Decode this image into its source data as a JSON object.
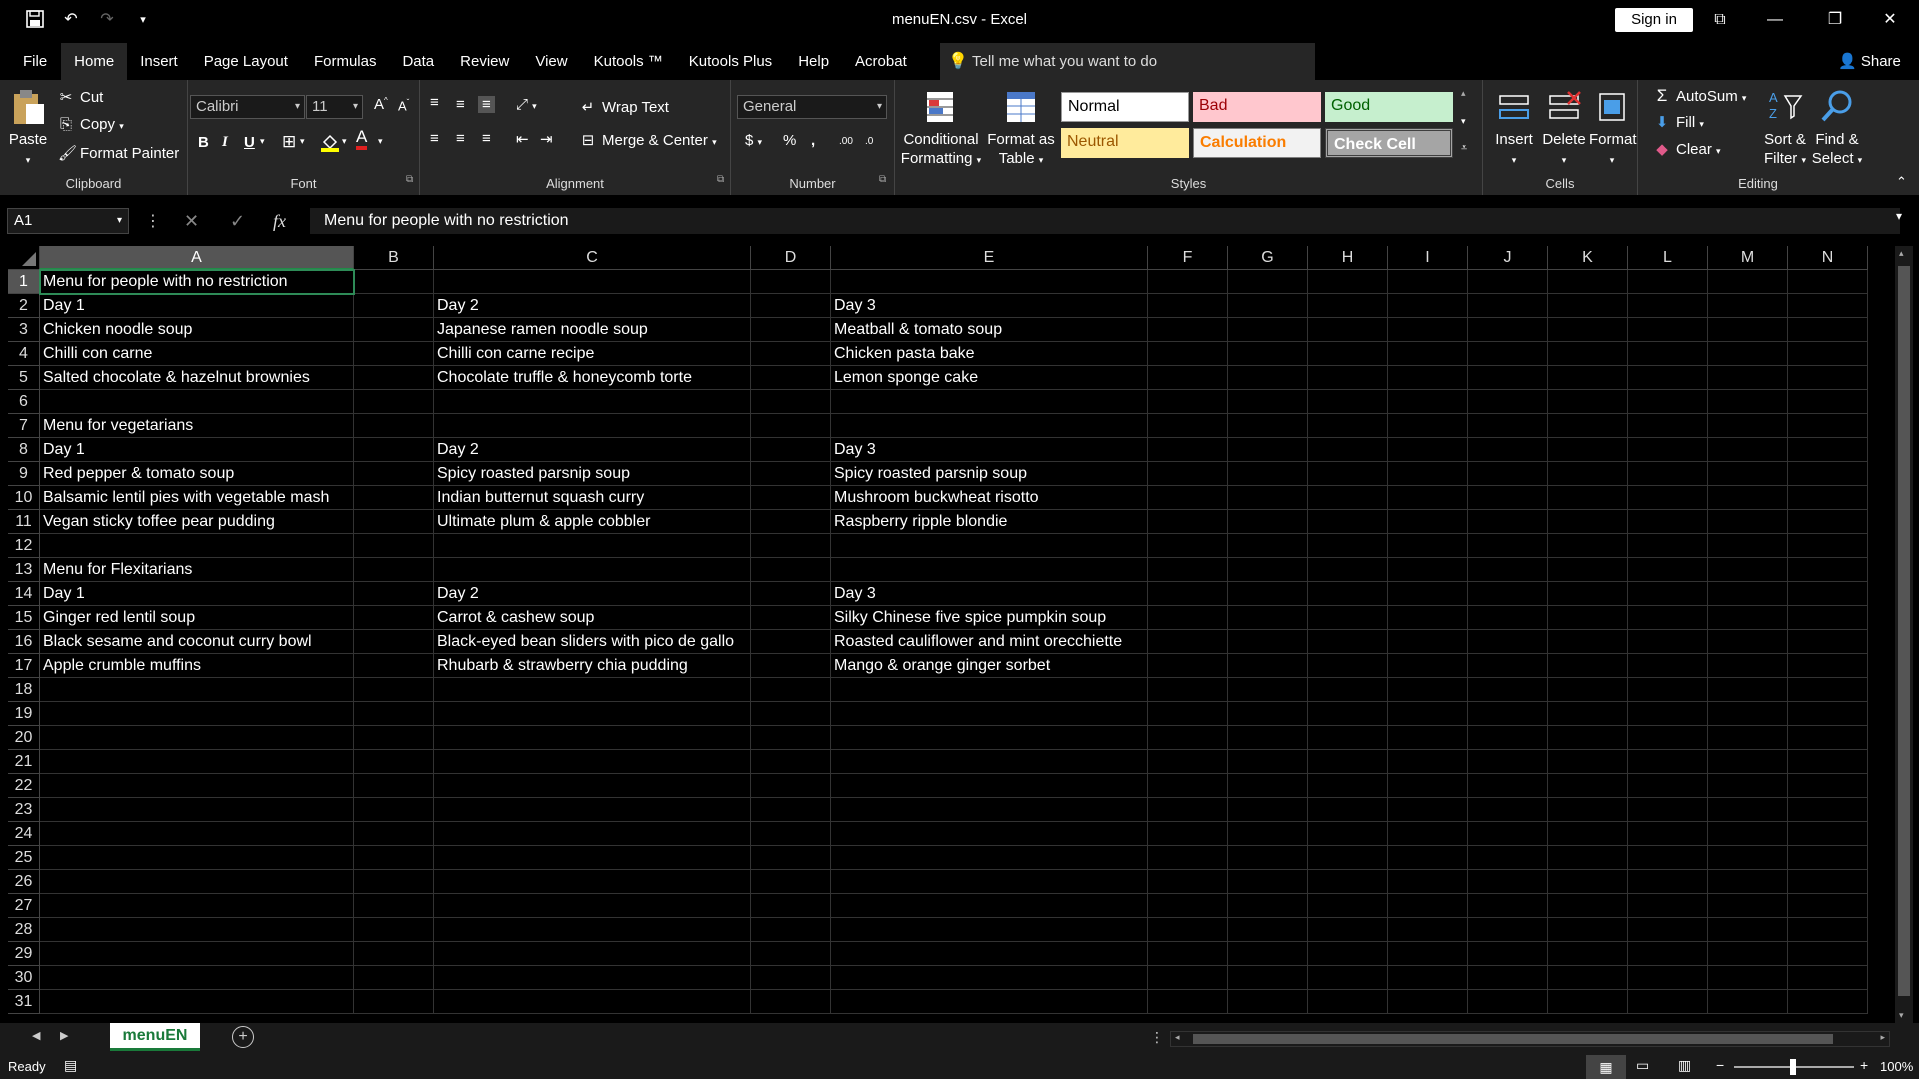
{
  "window": {
    "title": "menuEN.csv  -  Excel",
    "signin_label": "Sign in",
    "share_label": "Share"
  },
  "menu": {
    "tabs": [
      "File",
      "Home",
      "Insert",
      "Page Layout",
      "Formulas",
      "Data",
      "Review",
      "View",
      "Kutools ™",
      "Kutools Plus",
      "Help",
      "Acrobat"
    ],
    "active": "Home",
    "tell_me": "Tell me what you want to do"
  },
  "ribbon": {
    "clipboard": {
      "paste": "Paste",
      "cut": "Cut",
      "copy": "Copy",
      "format_painter": "Format Painter",
      "label": "Clipboard"
    },
    "font": {
      "name": "Calibri",
      "size": "11",
      "label": "Font"
    },
    "alignment": {
      "wrap_text": "Wrap Text",
      "merge_center": "Merge & Center",
      "label": "Alignment"
    },
    "number": {
      "format": "General",
      "label": "Number"
    },
    "styles": {
      "conditional_formatting": "Conditional Formatting",
      "format_as_table": "Format as Table",
      "normal": "Normal",
      "bad": "Bad",
      "good": "Good",
      "neutral": "Neutral",
      "calculation": "Calculation",
      "check_cell": "Check Cell",
      "label": "Styles"
    },
    "cells": {
      "insert": "Insert",
      "delete": "Delete",
      "format": "Format",
      "label": "Cells"
    },
    "editing": {
      "autosum": "AutoSum",
      "fill": "Fill",
      "clear": "Clear",
      "sort_filter": "Sort & Filter",
      "find_select": "Find & Select",
      "label": "Editing"
    }
  },
  "formula_bar": {
    "name_box": "A1",
    "formula": "Menu for people with no restriction"
  },
  "columns": [
    "A",
    "B",
    "C",
    "D",
    "E",
    "F",
    "G",
    "H",
    "I",
    "J",
    "K",
    "L",
    "M",
    "N"
  ],
  "rows": [
    {
      "n": "1",
      "A": "Menu for people with no restriction",
      "C": "",
      "E": ""
    },
    {
      "n": "2",
      "A": "Day 1",
      "C": "Day 2",
      "E": "Day 3"
    },
    {
      "n": "3",
      "A": "Chicken noodle soup",
      "C": "Japanese ramen noodle soup",
      "E": "Meatball & tomato soup"
    },
    {
      "n": "4",
      "A": "Chilli con carne",
      "C": "Chilli con carne recipe",
      "E": "Chicken pasta bake"
    },
    {
      "n": "5",
      "A": "Salted chocolate & hazelnut brownies",
      "C": "Chocolate truffle & honeycomb torte",
      "E": "Lemon sponge cake"
    },
    {
      "n": "6",
      "A": "",
      "C": "",
      "E": ""
    },
    {
      "n": "7",
      "A": "Menu for vegetarians",
      "C": "",
      "E": ""
    },
    {
      "n": "8",
      "A": "Day 1",
      "C": "Day 2",
      "E": "Day 3"
    },
    {
      "n": "9",
      "A": "Red pepper & tomato soup",
      "C": "Spicy roasted parsnip soup",
      "E": "Spicy roasted parsnip soup"
    },
    {
      "n": "10",
      "A": "Balsamic lentil pies with vegetable mash",
      "C": "Indian butternut squash curry",
      "E": "Mushroom buckwheat risotto"
    },
    {
      "n": "11",
      "A": "Vegan sticky toffee pear pudding",
      "C": "Ultimate plum & apple cobbler",
      "E": "Raspberry ripple blondie"
    },
    {
      "n": "12",
      "A": "",
      "C": "",
      "E": ""
    },
    {
      "n": "13",
      "A": "Menu for Flexitarians",
      "C": "",
      "E": ""
    },
    {
      "n": "14",
      "A": "Day 1",
      "C": "Day 2",
      "E": "Day 3"
    },
    {
      "n": "15",
      "A": "Ginger red lentil soup",
      "C": "Carrot & cashew soup",
      "E": "Silky Chinese five spice pumpkin soup"
    },
    {
      "n": "16",
      "A": "Black sesame and coconut curry bowl",
      "C": "Black-eyed bean sliders with pico de gallo",
      "E": "Roasted cauliflower and mint orecchiette"
    },
    {
      "n": "17",
      "A": "Apple crumble muffins",
      "C": "Rhubarb & strawberry chia pudding",
      "E": "Mango & orange ginger sorbet"
    },
    {
      "n": "18",
      "A": "",
      "C": "",
      "E": ""
    },
    {
      "n": "19",
      "A": "",
      "C": "",
      "E": ""
    },
    {
      "n": "20",
      "A": "",
      "C": "",
      "E": ""
    },
    {
      "n": "21",
      "A": "",
      "C": "",
      "E": ""
    },
    {
      "n": "22",
      "A": "",
      "C": "",
      "E": ""
    },
    {
      "n": "23",
      "A": "",
      "C": "",
      "E": ""
    },
    {
      "n": "24",
      "A": "",
      "C": "",
      "E": ""
    },
    {
      "n": "25",
      "A": "",
      "C": "",
      "E": ""
    },
    {
      "n": "26",
      "A": "",
      "C": "",
      "E": ""
    },
    {
      "n": "27",
      "A": "",
      "C": "",
      "E": ""
    },
    {
      "n": "28",
      "A": "",
      "C": "",
      "E": ""
    },
    {
      "n": "29",
      "A": "",
      "C": "",
      "E": ""
    },
    {
      "n": "30",
      "A": "",
      "C": "",
      "E": ""
    },
    {
      "n": "31",
      "A": "",
      "C": "",
      "E": ""
    }
  ],
  "sheet": {
    "tab": "menuEN"
  },
  "status": {
    "ready": "Ready",
    "zoom": "100%"
  },
  "colors": {
    "accent_green": "#218a47",
    "bad_bg": "#ffc7ce",
    "good_bg": "#c6efce",
    "neutral_bg": "#ffeb9c"
  }
}
